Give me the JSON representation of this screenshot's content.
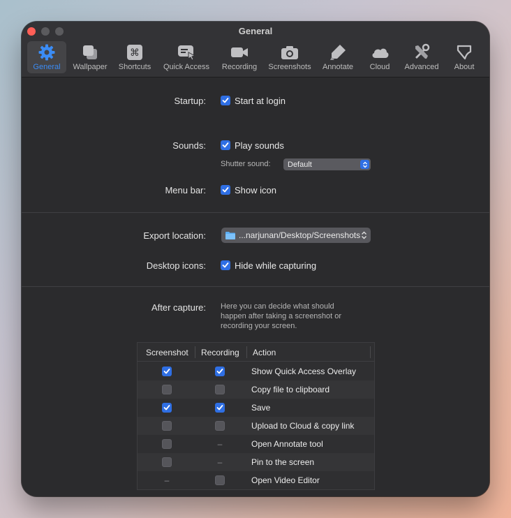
{
  "window": {
    "title": "General"
  },
  "toolbar": [
    {
      "label": "General",
      "icon": "gear-icon",
      "active": true
    },
    {
      "label": "Wallpaper",
      "icon": "wallpaper-icon",
      "active": false
    },
    {
      "label": "Shortcuts",
      "icon": "command-key-icon",
      "active": false
    },
    {
      "label": "Quick Access",
      "icon": "quick-access-icon",
      "active": false
    },
    {
      "label": "Recording",
      "icon": "video-camera-icon",
      "active": false
    },
    {
      "label": "Screenshots",
      "icon": "camera-icon",
      "active": false
    },
    {
      "label": "Annotate",
      "icon": "highlighter-icon",
      "active": false
    },
    {
      "label": "Cloud",
      "icon": "cloud-icon",
      "active": false
    },
    {
      "label": "Advanced",
      "icon": "tools-icon",
      "active": false
    },
    {
      "label": "About",
      "icon": "flag-icon",
      "active": false
    }
  ],
  "settings": {
    "startup": {
      "label": "Startup:",
      "option": "Start at login",
      "checked": true
    },
    "sounds": {
      "label": "Sounds:",
      "option": "Play sounds",
      "checked": true,
      "shutter_label": "Shutter sound:",
      "shutter_value": "Default"
    },
    "menubar": {
      "label": "Menu bar:",
      "option": "Show icon",
      "checked": true
    },
    "export": {
      "label": "Export location:",
      "path": "...narjunan/Desktop/Screenshots"
    },
    "desktop_icons": {
      "label": "Desktop icons:",
      "option": "Hide while capturing",
      "checked": true
    },
    "after_capture": {
      "label": "After capture:",
      "description": "Here you can decide what should happen after taking a screenshot or recording your screen."
    }
  },
  "table": {
    "headers": [
      "Screenshot",
      "Recording",
      "Action"
    ],
    "rows": [
      {
        "screenshot": "on",
        "recording": "on",
        "action": "Show Quick Access Overlay"
      },
      {
        "screenshot": "off",
        "recording": "off",
        "action": "Copy file to clipboard"
      },
      {
        "screenshot": "on",
        "recording": "on",
        "action": "Save"
      },
      {
        "screenshot": "off",
        "recording": "off",
        "action": "Upload to Cloud & copy link"
      },
      {
        "screenshot": "off",
        "recording": "na",
        "action": "Open Annotate tool"
      },
      {
        "screenshot": "off",
        "recording": "na",
        "action": "Pin to the screen"
      },
      {
        "screenshot": "na",
        "recording": "off",
        "action": "Open Video Editor"
      }
    ]
  },
  "colors": {
    "accent": "#2f6fe4",
    "active_tab_text": "#3b8cf5",
    "window_bg": "#2b2b2d"
  }
}
